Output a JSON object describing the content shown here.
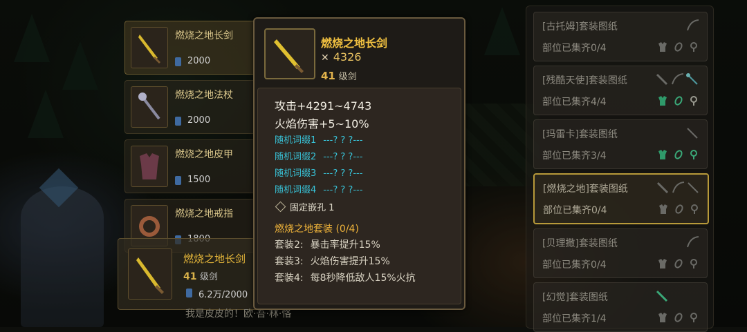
{
  "colors": {
    "gold": "#f0c040",
    "cyan": "#38c3d8",
    "gray_text": "#8d8a80"
  },
  "left_list": {
    "items": [
      {
        "name": "燃烧之地长剑",
        "price": "2000",
        "icon": "sword-icon"
      },
      {
        "name": "燃烧之地法杖",
        "price": "2000",
        "icon": "staff-icon"
      },
      {
        "name": "燃烧之地皮甲",
        "price": "1500",
        "icon": "leather-armor-icon"
      },
      {
        "name": "燃烧之地戒指",
        "price": "1800",
        "icon": "ring-icon"
      }
    ],
    "selected": {
      "name": "燃烧之地长剑",
      "level": "41",
      "level_unit": "级剑",
      "price": "6.2万/2000"
    },
    "helper": "我是皮皮的！欧·吾·林·恪"
  },
  "tooltip": {
    "name": "燃烧之地长剑",
    "power": "4326",
    "level": "41",
    "level_unit": "级剑",
    "attack": "攻击+4291~4743",
    "fire_damage": "火焰伤害+5~10%",
    "random_affixes": [
      {
        "label": "随机词缀1",
        "value": "---? ? ?---"
      },
      {
        "label": "随机词缀2",
        "value": "---? ? ?---"
      },
      {
        "label": "随机词缀3",
        "value": "---? ? ?---"
      },
      {
        "label": "随机词缀4",
        "value": "---? ? ?---"
      }
    ],
    "socket": "固定嵌孔 1",
    "set_title": "燃烧之地套装 (0/4)",
    "set_bonuses": [
      {
        "label": "套装2:",
        "value": "暴击率提升15%"
      },
      {
        "label": "套装3:",
        "value": "火焰伤害提升15%"
      },
      {
        "label": "套装4:",
        "value": "每8秒降低敌人15%火抗"
      }
    ]
  },
  "right_panel": {
    "items": [
      {
        "title": "[古托姆]套装图纸",
        "status": "部位已集齐0/4",
        "collected": [
          false,
          false,
          false
        ],
        "weapons": [
          "bow-icon"
        ]
      },
      {
        "title": "[残酷天使]套装图纸",
        "status": "部位已集齐4/4",
        "collected": [
          true,
          true,
          true
        ],
        "weapons": [
          "sword-icon",
          "bow-icon",
          "staff-icon"
        ]
      },
      {
        "title": "[玛雷卡]套装图纸",
        "status": "部位已集齐3/4",
        "collected": [
          true,
          true,
          true
        ],
        "weapons": [
          "staff-icon"
        ]
      },
      {
        "title": "[燃烧之地]套装图纸",
        "status": "部位已集齐0/4",
        "collected": [
          false,
          false,
          false
        ],
        "weapons": [
          "sword-icon",
          "bow-icon",
          "staff-icon"
        ]
      },
      {
        "title": "[贝理撒]套装图纸",
        "status": "部位已集齐0/4",
        "collected": [
          false,
          false,
          false
        ],
        "weapons": [
          "bow-icon"
        ]
      },
      {
        "title": "[幻觉]套装图纸",
        "status": "部位已集齐1/4",
        "collected": [
          false,
          false,
          false
        ],
        "weapons": [
          "sword-icon"
        ]
      }
    ]
  }
}
